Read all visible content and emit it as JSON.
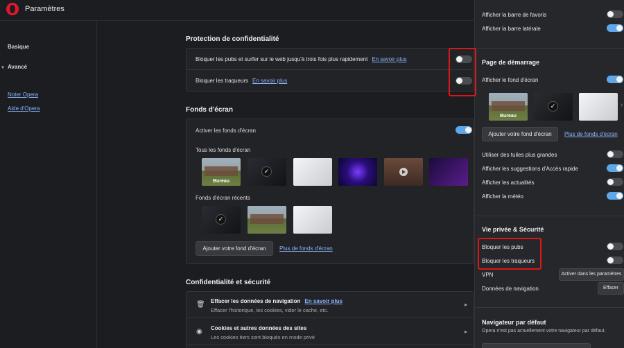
{
  "app": {
    "title": "Paramètres"
  },
  "sidebar": {
    "basic": "Basique",
    "advanced": "Avancé",
    "links": [
      "Noter Opera",
      "Aide d'Opera"
    ]
  },
  "privacy_protection": {
    "title": "Protection de confidentialité",
    "rows": [
      {
        "label": "Bloquer les pubs et surfer sur le web jusqu'à trois fois plus rapidement",
        "link": "En savoir plus",
        "enabled": false
      },
      {
        "label": "Bloquer les traqueurs",
        "link": "En savoir plus",
        "enabled": false
      }
    ]
  },
  "wallpapers": {
    "title": "Fonds d'écran",
    "enable_label": "Activer les fonds d'écran",
    "enabled": true,
    "all_label": "Tous les fonds d'écran",
    "first_thumb_label": "Bureau",
    "recent_label": "Fonds d'écran récents",
    "add_button": "Ajouter votre fond d'écran",
    "more_link": "Plus de fonds d'écran"
  },
  "privacy_security": {
    "title": "Confidentialité et sécurité",
    "rows": [
      {
        "title": "Effacer les données de navigation",
        "link": "En savoir plus",
        "subtitle": "Effacer l'historique, les cookies, vider le cache, etc."
      },
      {
        "title": "Cookies et autres données des sites",
        "link": "",
        "subtitle": "Les cookies tiers sont bloqués en mode privé"
      }
    ]
  },
  "panel": {
    "top_rows": [
      {
        "label": "Afficher la barre de favoris",
        "enabled": false
      },
      {
        "label": "Afficher la barre latérale",
        "enabled": true
      }
    ],
    "start_page": {
      "title": "Page de démarrage",
      "wallpaper_label": "Afficher le fond d'écran",
      "wallpaper_enabled": true,
      "thumb_label": "Bureau",
      "add_button": "Ajouter votre fond d'écran",
      "more_link": "Plus de fonds d'écran",
      "rows": [
        {
          "label": "Utiliser des tuiles plus grandes",
          "enabled": false
        },
        {
          "label": "Afficher les suggestions d'Accès rapide",
          "enabled": true
        },
        {
          "label": "Afficher les actualités",
          "enabled": false
        },
        {
          "label": "Afficher la météo",
          "enabled": true
        }
      ]
    },
    "privacy": {
      "title": "Vie privée & Sécurité",
      "block_ads": "Bloquer les pubs",
      "block_ads_enabled": false,
      "block_trackers": "Bloquer les traqueurs",
      "block_trackers_enabled": false,
      "vpn": "VPN",
      "vpn_button": "Activer dans les paramètres",
      "browsing_data": "Données de navigation",
      "clear_button": "Effacer"
    },
    "default_browser": {
      "title": "Navigateur par défaut",
      "note": "Opera n'est pas actuellement votre navigateur par défaut."
    }
  },
  "colors": {
    "accent": "#5fa8e8",
    "link": "#8ab4f8",
    "highlight": "#e01616",
    "background": "#1c1d21"
  }
}
